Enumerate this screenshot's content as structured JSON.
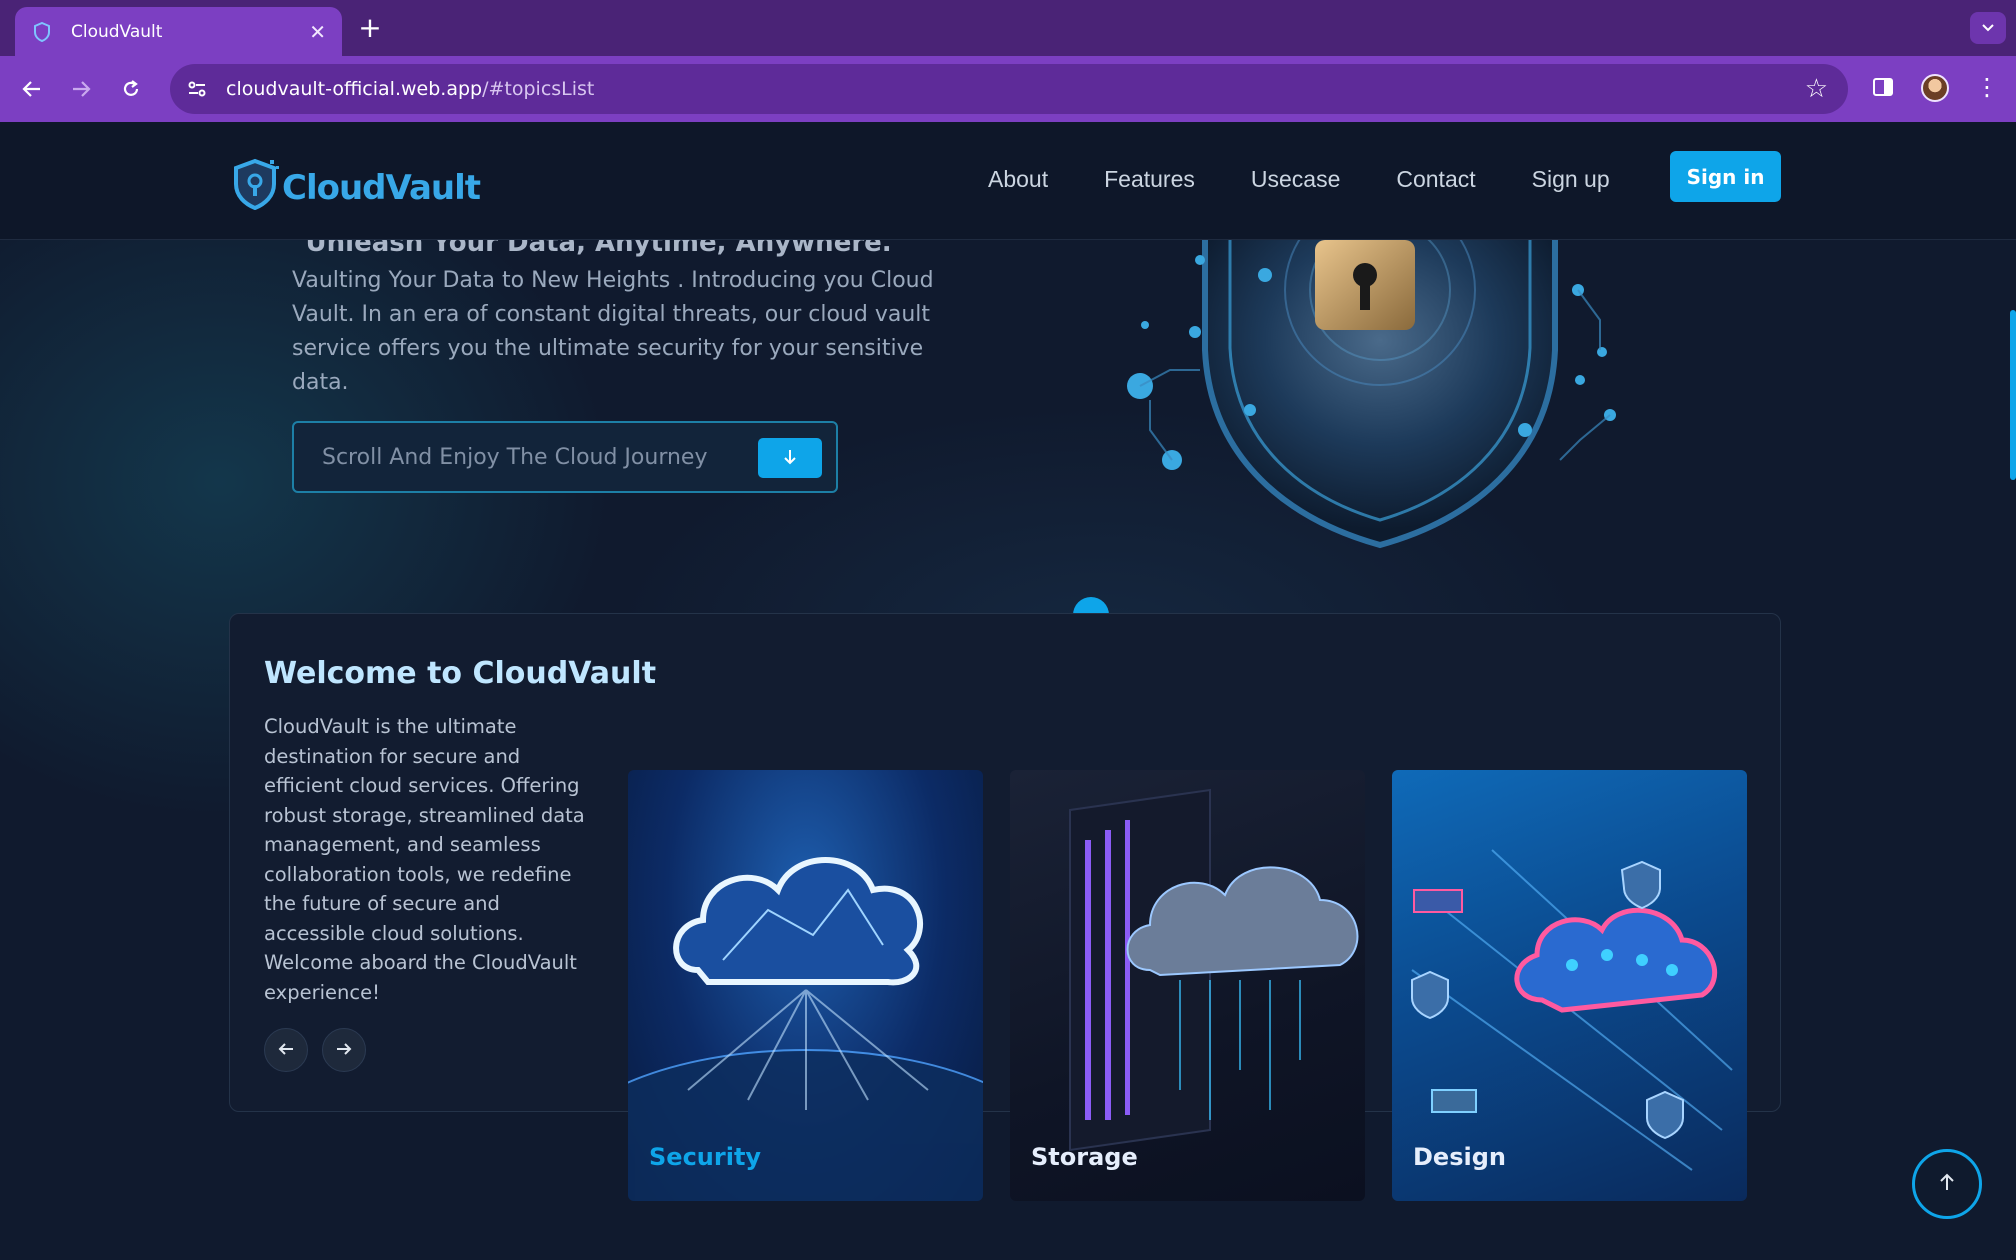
{
  "browser": {
    "tab_title": "CloudVault",
    "url_host": "cloudvault-official.web.app",
    "url_path": "/#topicsList"
  },
  "header": {
    "brand": "CloudVault",
    "nav": [
      "About",
      "Features",
      "Usecase",
      "Contact",
      "Sign up"
    ],
    "signin_label": "Sign in"
  },
  "hero": {
    "tagline": "\"Unleash Your Data, Anytime, Anywhere.\"",
    "description": "Vaulting Your Data to New Heights . Introducing you Cloud Vault. In an era of constant digital threats, our cloud vault service offers you the ultimate security for your sensitive data.",
    "scroll_label": "Scroll And Enjoy The Cloud Journey"
  },
  "welcome": {
    "title": "Welcome to CloudVault",
    "body": "CloudVault is the ultimate destination for secure and efficient cloud services. Offering robust storage, streamlined data management, and seamless collaboration tools, we redefine the future of secure and accessible cloud solutions. Welcome aboard the CloudVault experience!"
  },
  "cards": [
    {
      "label": "Security",
      "active": true
    },
    {
      "label": "Storage",
      "active": false
    },
    {
      "label": "Design",
      "active": false
    }
  ],
  "colors": {
    "accent": "#0ea5e9",
    "browser_frame": "#7c3fc2",
    "page_bg": "#101a2e"
  }
}
